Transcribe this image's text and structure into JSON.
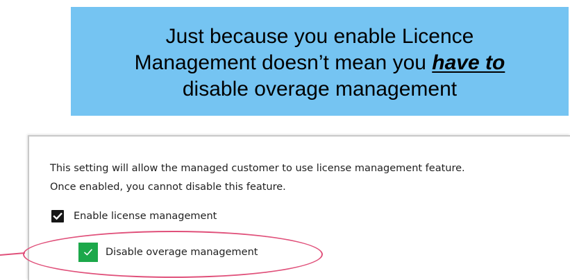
{
  "callout": {
    "line1": "Just because you enable Licence",
    "line2_prefix": "Management doesn’t mean you ",
    "line2_emphasis": "have to",
    "line3": "disable overage management",
    "background_color": "#75c4f2"
  },
  "settings_panel": {
    "description_line1": "This setting will allow the managed customer to use license management feature.",
    "description_line2": "Once enabled, you cannot disable this feature.",
    "enable_license_management": {
      "label": "Enable license management",
      "checked": true,
      "icon": "checkmark-icon",
      "checkbox_color": "#161616"
    },
    "disable_overage_management": {
      "label": "Disable overage management",
      "checked": true,
      "icon": "checkmark-icon",
      "checkbox_color": "#1ca84a"
    }
  },
  "annotation": {
    "highlight_color": "#e0507a"
  }
}
